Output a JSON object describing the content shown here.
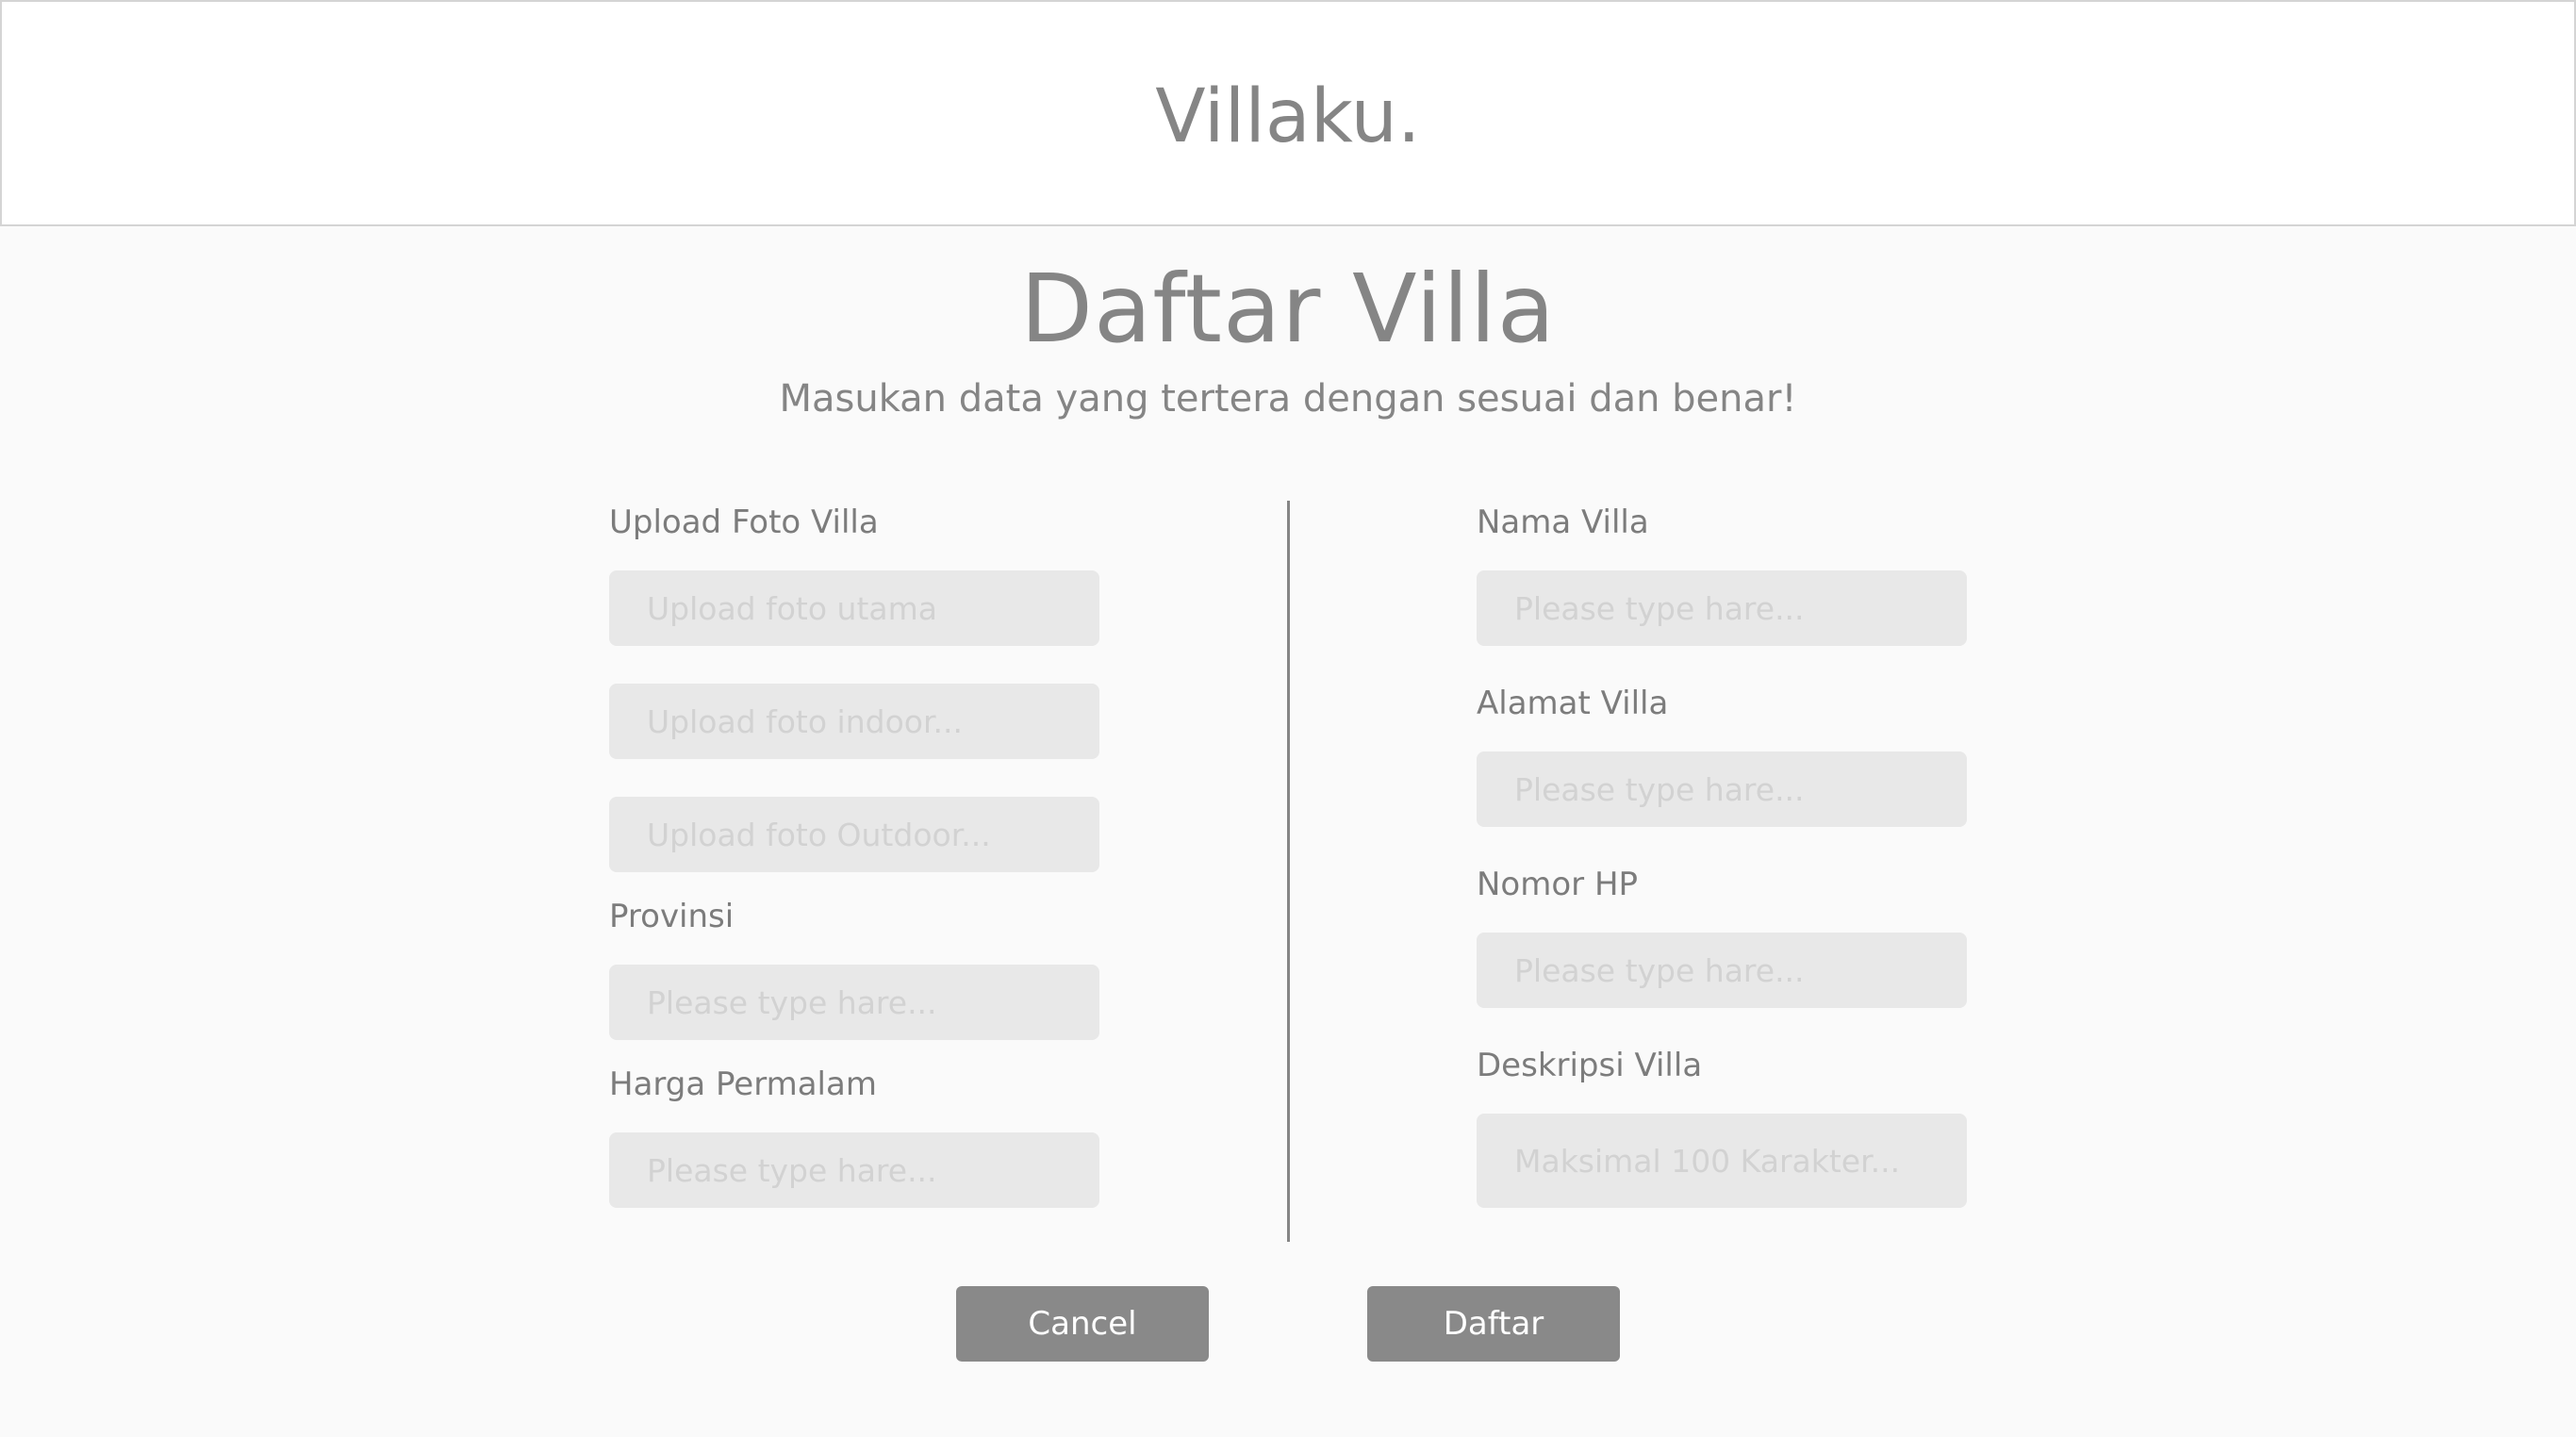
{
  "header": {
    "brand": "Villaku."
  },
  "page": {
    "title": "Daftar Villa",
    "subtitle": "Masukan data yang tertera dengan sesuai dan benar!"
  },
  "form": {
    "left": {
      "upload_label": "Upload Foto Villa",
      "upload_main_placeholder": "Upload foto utama",
      "upload_indoor_placeholder": "Upload foto indoor...",
      "upload_outdoor_placeholder": "Upload foto Outdoor...",
      "provinsi_label": "Provinsi",
      "provinsi_placeholder": "Please type hare...",
      "harga_label": "Harga Permalam",
      "harga_placeholder": "Please type hare..."
    },
    "right": {
      "nama_label": "Nama Villa",
      "nama_placeholder": "Please type hare...",
      "alamat_label": "Alamat Villa",
      "alamat_placeholder": "Please type hare...",
      "nomor_label": "Nomor HP",
      "nomor_placeholder": "Please type hare...",
      "deskripsi_label": "Deskripsi Villa",
      "deskripsi_placeholder": "Maksimal 100 Karakter..."
    }
  },
  "actions": {
    "cancel_label": "Cancel",
    "submit_label": "Daftar"
  },
  "colors": {
    "text": "#858585",
    "input_bg": "#e8e8e8",
    "button_bg": "#898989",
    "page_bg": "#fafafa"
  }
}
